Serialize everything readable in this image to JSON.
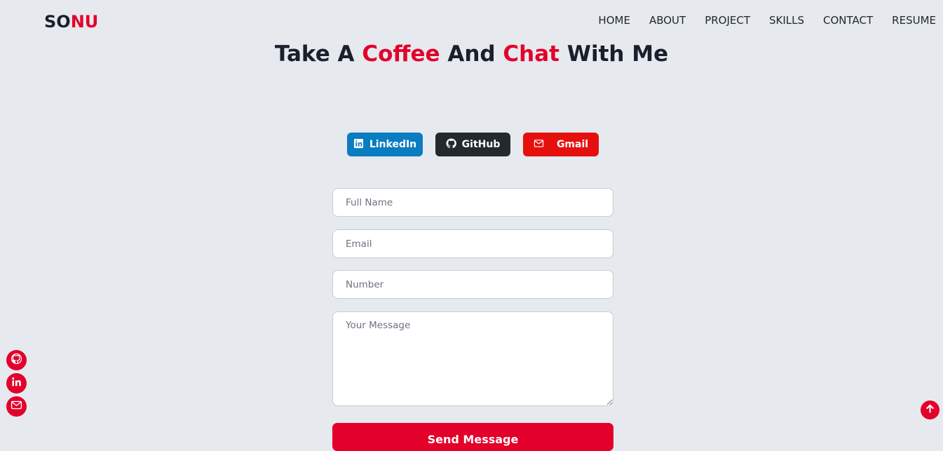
{
  "header": {
    "logo_part1": "SO",
    "logo_part2": "NU",
    "nav": [
      "HOME",
      "ABOUT",
      "PROJECT",
      "SKILLS",
      "CONTACT",
      "RESUME"
    ]
  },
  "title": {
    "w1": "Take A ",
    "w2": "Coffee",
    "w3": " And ",
    "w4": "Chat",
    "w5": " With Me"
  },
  "socials": {
    "linkedin": "LinkedIn",
    "github": "GitHub",
    "gmail": "Gmail"
  },
  "form": {
    "name_placeholder": "Full Name",
    "email_placeholder": "Email",
    "number_placeholder": "Number",
    "message_placeholder": "Your Message",
    "submit": "Send Message"
  },
  "colors": {
    "accent": "#e3002a",
    "background": "#e6eaef",
    "linkedin": "#0a7cc1",
    "github": "#24292e",
    "gmail": "#e5100e"
  },
  "icons": {
    "float": [
      "github-icon",
      "linkedin-icon",
      "mail-icon"
    ],
    "scroll": "arrow-up-icon"
  }
}
